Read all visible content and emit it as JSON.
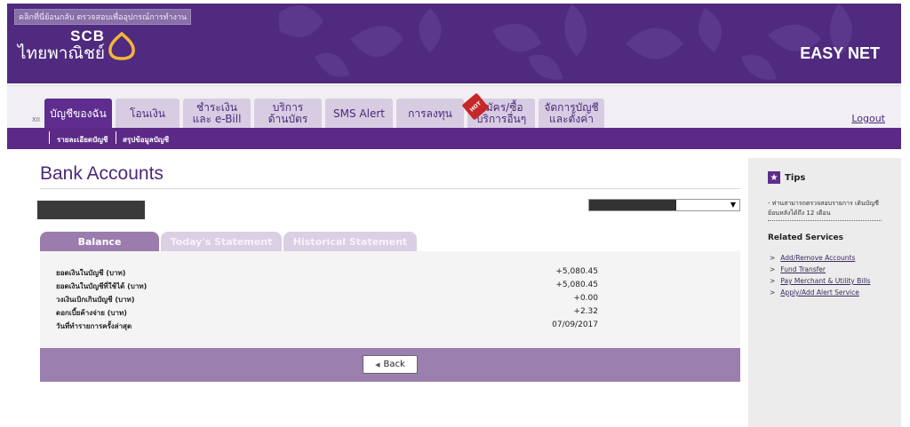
{
  "header": {
    "top_link": "คลิกที่นี่ย้อนกลับ ตรวจสอบเพื่ออุปกรณ์การทำงาน",
    "brand_en": "SCB",
    "brand_th": "ไทยพาณิชย์",
    "product": "EASY NET",
    "bg_color": "#4f2a7f"
  },
  "nav": {
    "tabs": [
      {
        "label": "บัญชีของฉัน"
      },
      {
        "label": "โอนเงิน"
      },
      {
        "label_1": "ชำระเงิน",
        "label_2": "และ e-Bill"
      },
      {
        "label_1": "บริการ",
        "label_2": "ด้านบัตร"
      },
      {
        "label": "SMS Alert"
      },
      {
        "label": "การลงทุน"
      },
      {
        "label_1": "สมัคร/ซื้อ",
        "label_2": "บริการอื่นๆ"
      },
      {
        "label_1": "จัดการบัญชี",
        "label_2": "และตั้งค่า"
      }
    ],
    "xii": "XII",
    "hot_badge": "HOT",
    "logout": "Logout"
  },
  "subnav": {
    "items": [
      "รายละเอียดบัญชี",
      "สรุปข้อมูลบัญชี"
    ]
  },
  "main": {
    "title": "Bank Accounts",
    "select_arrow": "▼",
    "content_tabs": [
      "Balance",
      "Today's Statement",
      "Historical Statement"
    ],
    "rows": [
      {
        "label": "ยอดเงินในบัญชี (บาท)",
        "value": "+5,080.45"
      },
      {
        "label": "ยอดเงินในบัญชีที่ใช้ได้ (บาท)",
        "value": "+5,080.45"
      },
      {
        "label": "วงเงินเบิกเกินบัญชี (บาท)",
        "value": "+0.00"
      },
      {
        "label": "ดอกเบี้ยค้างจ่าย (บาท)",
        "value": "+2.32"
      },
      {
        "label": "วันที่ทำรายการครั้งล่าสุด",
        "value": "07/09/2017"
      }
    ],
    "back_label": "Back"
  },
  "sidebar": {
    "tips_title": "Tips",
    "tip_text": "- ท่านสามารถตรวจสอบรายการ เดินบัญชีย้อนหลังได้ถึง 12 เดือน",
    "related_title": "Related Services",
    "links": [
      "Add/Remove Accounts",
      "Fund Transfer",
      "Pay Merchant & Utility Bills",
      "Apply/Add Alert Service"
    ]
  }
}
